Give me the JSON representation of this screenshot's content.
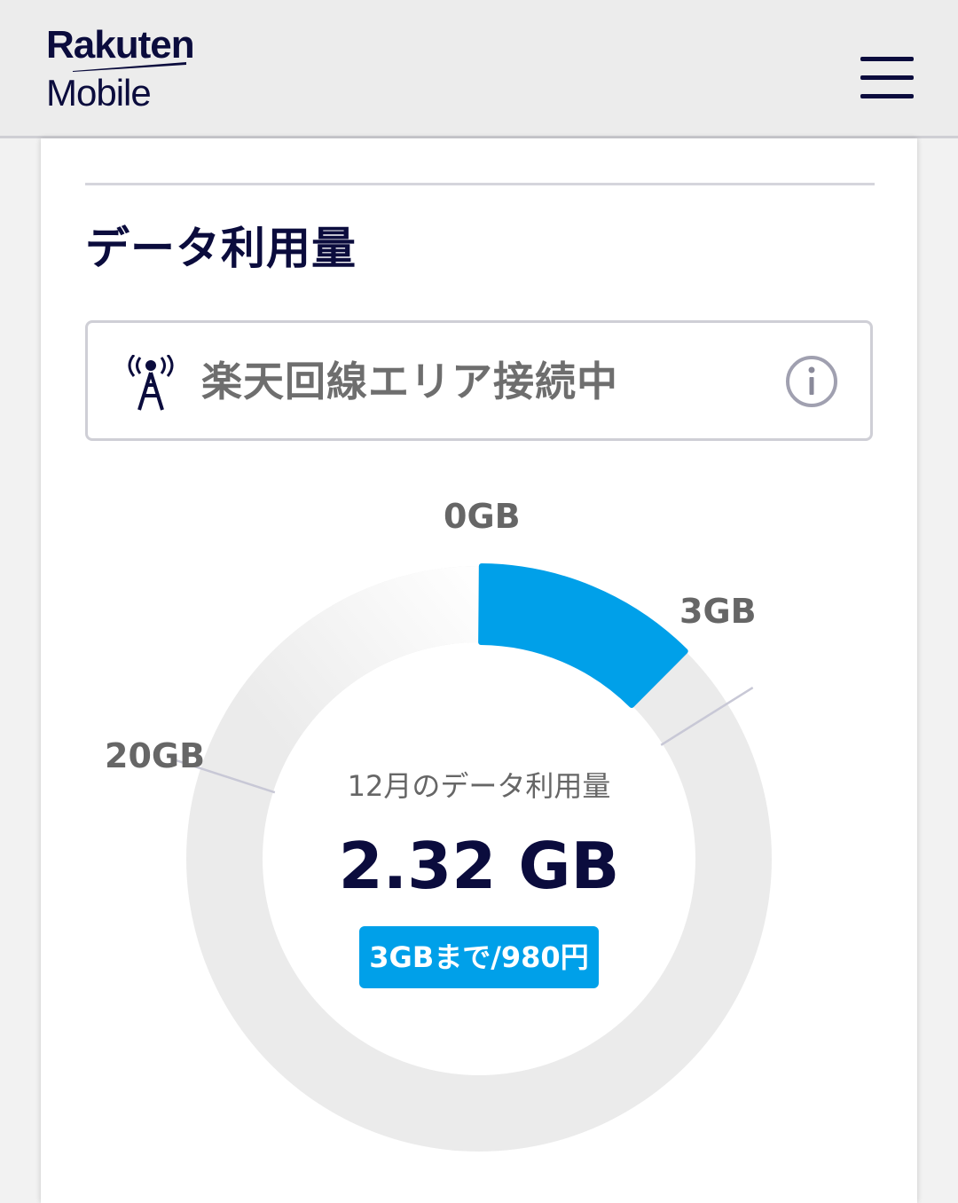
{
  "header": {
    "logo_line1": "Rakuten",
    "logo_line2": "Mobile",
    "menu_icon": "hamburger-menu-icon"
  },
  "section": {
    "title": "データ利用量"
  },
  "network_status": {
    "icon": "signal-tower-icon",
    "text": "楽天回線エリア接続中",
    "info_icon": "info-icon"
  },
  "usage": {
    "caption": "12月のデータ利用量",
    "value": "2.32 GB",
    "plan_badge": "3GBまで/980円"
  },
  "colors": {
    "brand_navy": "#0b0c3d",
    "accent_blue": "#00a0e9",
    "track_gray": "#ebebeb"
  },
  "chart_data": {
    "type": "gauge",
    "unit": "GB",
    "used": 2.32,
    "tiers": [
      0,
      3,
      20
    ],
    "tick_labels": [
      "0GB",
      "3GB",
      "20GB"
    ]
  }
}
